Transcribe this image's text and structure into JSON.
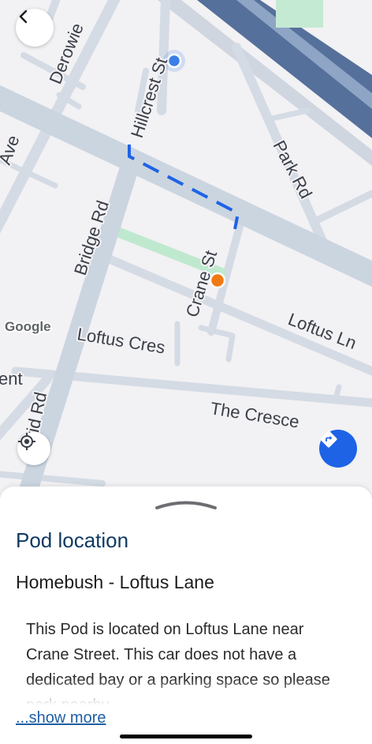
{
  "map": {
    "streets": {
      "derowie": "Derowie",
      "hillcrest": "Hillcrest St",
      "ave": "Ave",
      "park": "Park Rd",
      "bridge": "Bridge Rd",
      "crane": "Crane St",
      "loftus_ln": "Loftus Ln",
      "loftus_cres": "Loftus Cres",
      "ent": "ent",
      "the_cresc": "The Cresce",
      "brid_rd": "Brid Rd"
    },
    "attribution": "Google",
    "icons": {
      "back": "chevron-left-icon",
      "locate": "my-location-icon",
      "directions": "directions-icon"
    },
    "colors": {
      "route": "#1e63e6",
      "user_dot": "#3b7fe6",
      "pod_pin": "#ef7a14",
      "green_path": "#bfe9cf"
    }
  },
  "sheet": {
    "title": "Pod location",
    "pod_name": "Homebush - Loftus Lane",
    "description": "This Pod is located on Loftus Lane near Crane Street. This car does not have a dedicated bay or a parking space so please park nearby.",
    "show_more": "...show more"
  }
}
